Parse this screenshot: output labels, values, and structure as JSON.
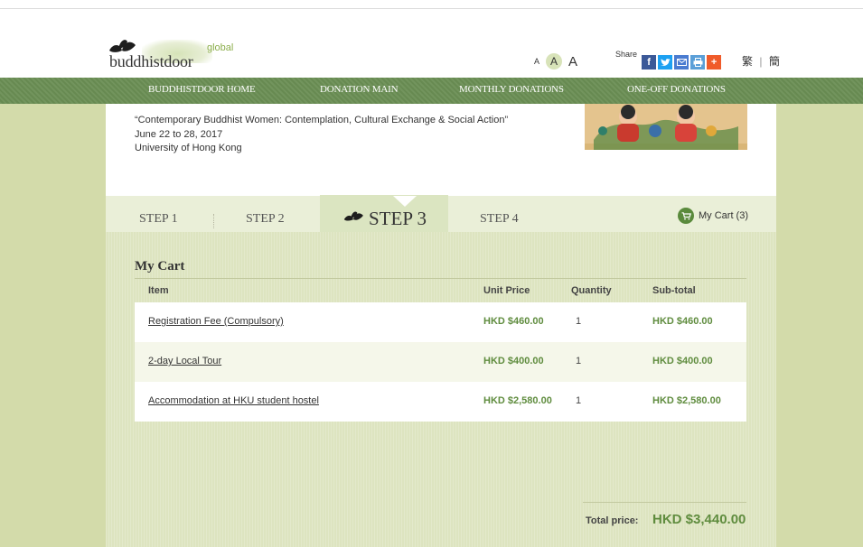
{
  "header": {
    "logo": {
      "global": "global",
      "name": "buddhistdoor"
    },
    "font_sizes": {
      "small": "A",
      "medium": "A",
      "large": "A"
    },
    "share_label": "Share",
    "share_buttons": [
      {
        "icon": "facebook-icon",
        "glyph": "f"
      },
      {
        "icon": "twitter-icon",
        "glyph": "t"
      },
      {
        "icon": "mail-icon",
        "glyph": "✉"
      },
      {
        "icon": "print-icon",
        "glyph": "⎙"
      },
      {
        "icon": "plus-icon",
        "glyph": "+"
      }
    ],
    "lang": {
      "traditional": "繁",
      "divider": "|",
      "simplified": "簡"
    }
  },
  "nav": {
    "items": [
      "BUDDHISTDOOR HOME",
      "DONATION MAIN",
      "MONTHLY DONATIONS",
      "ONE-OFF DONATIONS"
    ]
  },
  "event": {
    "title": "“Contemporary Buddhist Women: Contemplation, Cultural Exchange & Social Action”",
    "dates": "June 22 to 28, 2017",
    "venue": "University of Hong Kong"
  },
  "steps": {
    "items": [
      "STEP 1",
      "STEP 2",
      "STEP 3",
      "STEP 4"
    ],
    "active": "STEP 3",
    "cart_link": "My Cart (3)"
  },
  "cart": {
    "title": "My Cart",
    "columns": [
      "Item",
      "Unit Price",
      "Quantity",
      "Sub-total"
    ],
    "rows": [
      {
        "item": "Registration Fee (Compulsory)",
        "unit_price": "HKD $460.00",
        "quantity": "1",
        "subtotal": "HKD $460.00"
      },
      {
        "item": "2-day Local Tour",
        "unit_price": "HKD $400.00",
        "quantity": "1",
        "subtotal": "HKD $400.00"
      },
      {
        "item": "Accommodation at HKU student hostel",
        "unit_price": "HKD $2,580.00",
        "quantity": "1",
        "subtotal": "HKD $2,580.00"
      }
    ],
    "total_label": "Total price:",
    "total_value": "HKD $3,440.00"
  },
  "colors": {
    "nav_green": "#6a8e54",
    "side_green": "#d3dbaa",
    "price_green": "#5f8c3e",
    "cart_bg": "#dde4c0"
  }
}
